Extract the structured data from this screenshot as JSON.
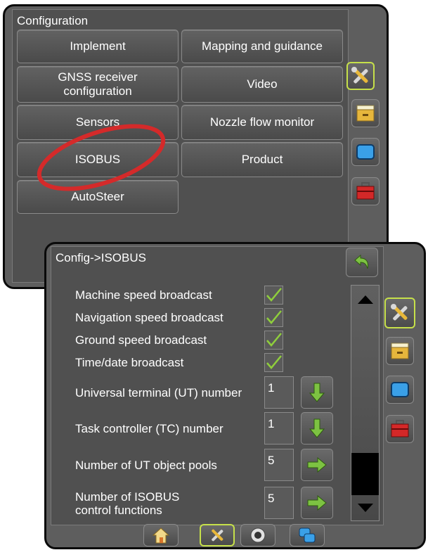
{
  "config_panel": {
    "title": "Configuration",
    "buttons": {
      "implement": "Implement",
      "mapping": "Mapping and guidance",
      "gnss_line1": "GNSS receiver",
      "gnss_line2": "configuration",
      "video": "Video",
      "sensors": "Sensors",
      "nozzle": "Nozzle flow monitor",
      "isobus": "ISOBUS",
      "product": "Product",
      "autosteer": "AutoSteer"
    }
  },
  "isobus_panel": {
    "title": "Config->ISOBUS",
    "options": [
      {
        "label": "Machine speed broadcast",
        "checked": true
      },
      {
        "label": "Navigation speed broadcast",
        "checked": true
      },
      {
        "label": "Ground speed broadcast",
        "checked": true
      },
      {
        "label": "Time/date broadcast",
        "checked": true
      }
    ],
    "fields": [
      {
        "label": "Universal terminal (UT) number",
        "value": "1"
      },
      {
        "label": "Task controller (TC) number",
        "value": "1"
      },
      {
        "label": "Number of UT object pools",
        "value": "5"
      },
      {
        "label_line1": "Number of ISOBUS",
        "label_line2": "control functions",
        "value": "5"
      }
    ]
  },
  "side_icons": [
    "tools-icon",
    "folder-icon",
    "screen-icon",
    "toolbox-icon"
  ],
  "bottom_tabs": [
    "home-icon",
    "tools-icon",
    "camera-icon",
    "multi-screen-icon"
  ],
  "colors": {
    "accent": "#c6e04a",
    "highlight_circle": "#d42a2a",
    "panel": "#5e5e5e",
    "check": "#8fce3c",
    "arrow": "#7dc242"
  }
}
